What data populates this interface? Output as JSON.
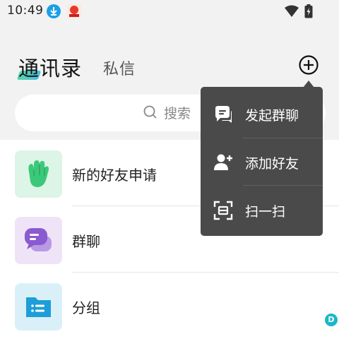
{
  "status_bar": {
    "time": "10:49"
  },
  "header": {
    "active_tab": "通讯录",
    "inactive_tab": "私信"
  },
  "search": {
    "placeholder": "搜索"
  },
  "list": [
    {
      "label": "新的好友申请",
      "icon": "waving-hand-icon",
      "color": "#3cc87a"
    },
    {
      "label": "群聊",
      "icon": "chat-bubbles-icon",
      "color": "#8a5ad0"
    },
    {
      "label": "分组",
      "icon": "folder-list-icon",
      "color": "#1e9ed8"
    }
  ],
  "menu": [
    {
      "label": "发起群聊",
      "icon": "group-chat-icon"
    },
    {
      "label": "添加好友",
      "icon": "add-friend-icon"
    },
    {
      "label": "扫一扫",
      "icon": "scan-icon"
    }
  ],
  "badge": "D"
}
